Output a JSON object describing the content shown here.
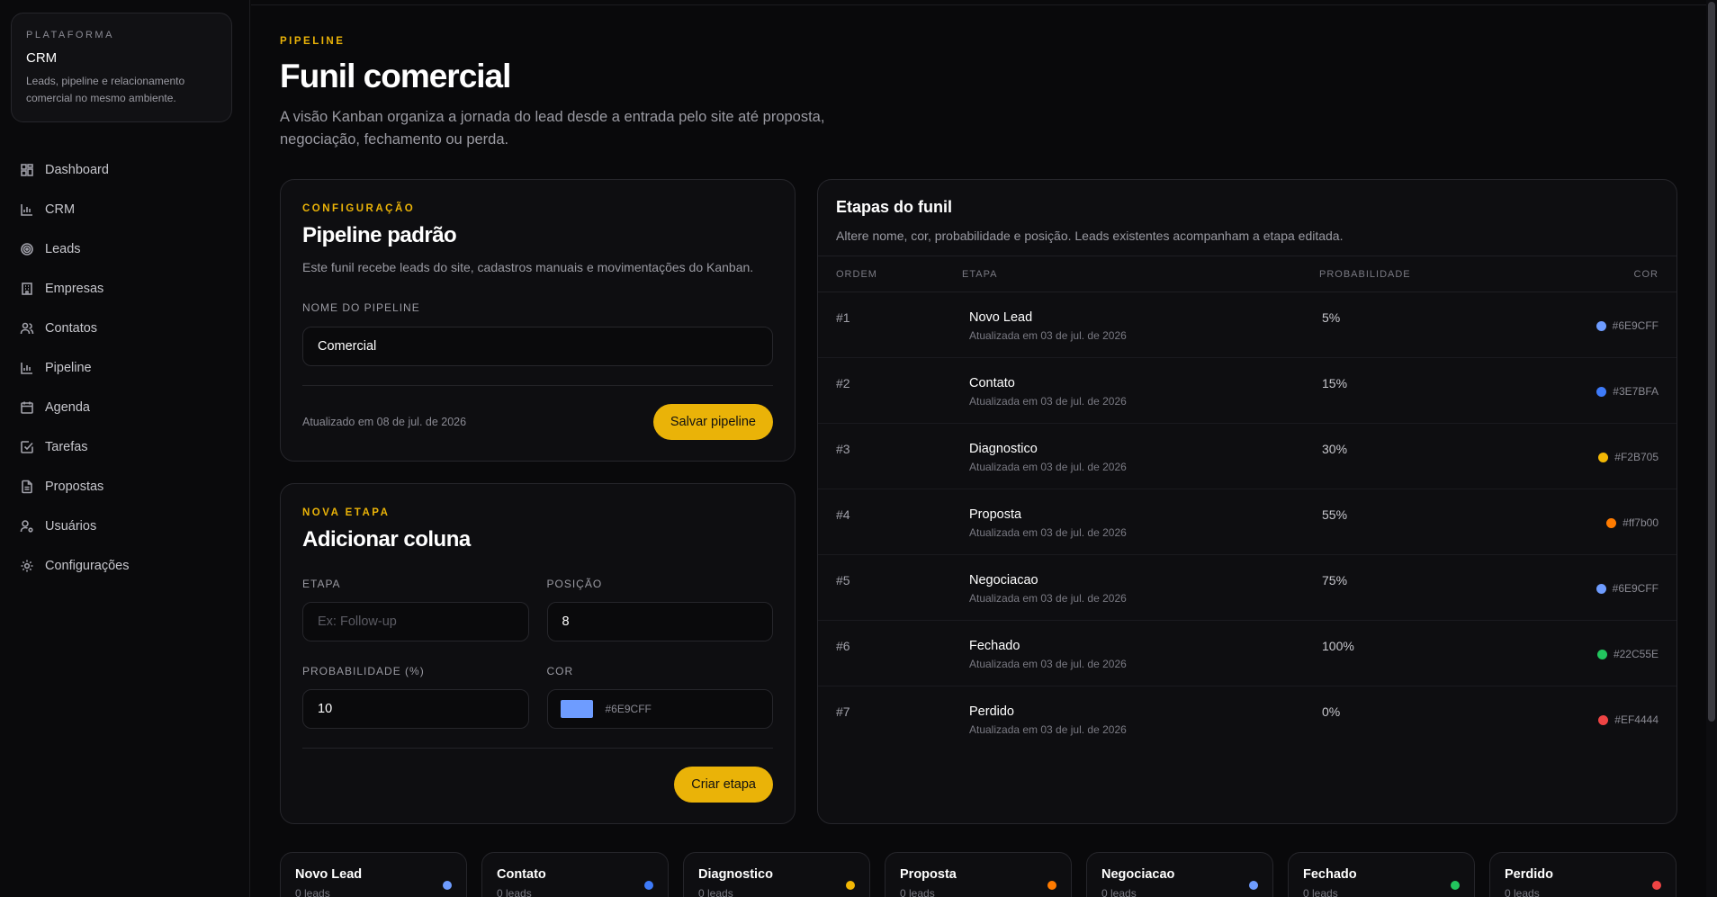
{
  "sidebar": {
    "eyebrow": "PLATAFORMA",
    "title": "CRM",
    "description": "Leads, pipeline e relacionamento comercial no mesmo ambiente.",
    "items": [
      {
        "label": "Dashboard",
        "icon": "grid-icon"
      },
      {
        "label": "CRM",
        "icon": "bar-chart-icon"
      },
      {
        "label": "Leads",
        "icon": "target-icon"
      },
      {
        "label": "Empresas",
        "icon": "building-icon"
      },
      {
        "label": "Contatos",
        "icon": "users-icon"
      },
      {
        "label": "Pipeline",
        "icon": "bar-chart-icon"
      },
      {
        "label": "Agenda",
        "icon": "calendar-icon"
      },
      {
        "label": "Tarefas",
        "icon": "check-square-icon"
      },
      {
        "label": "Propostas",
        "icon": "file-text-icon"
      },
      {
        "label": "Usuários",
        "icon": "user-cog-icon"
      },
      {
        "label": "Configurações",
        "icon": "gear-icon"
      }
    ]
  },
  "page": {
    "eyebrow": "PIPELINE",
    "title": "Funil comercial",
    "description": "A visão Kanban organiza a jornada do lead desde a entrada pelo site até proposta, negociação, fechamento ou perda."
  },
  "config": {
    "eyebrow": "CONFIGURAÇÃO",
    "title": "Pipeline padrão",
    "description": "Este funil recebe leads do site, cadastros manuais e movimentações do Kanban.",
    "name_label": "NOME DO PIPELINE",
    "name_value": "Comercial",
    "updated": "Atualizado em 08 de jul. de 2026",
    "save_label": "Salvar pipeline"
  },
  "new_stage": {
    "eyebrow": "NOVA ETAPA",
    "title": "Adicionar coluna",
    "stage_label": "ETAPA",
    "stage_placeholder": "Ex: Follow-up",
    "position_label": "POSIÇÃO",
    "position_value": "8",
    "prob_label": "PROBABILIDADE (%)",
    "prob_value": "10",
    "color_label": "COR",
    "color_value": "#6E9CFF",
    "create_label": "Criar etapa"
  },
  "stages": {
    "title": "Etapas do funil",
    "description": "Altere nome, cor, probabilidade e posição. Leads existentes acompanham a etapa editada.",
    "headers": {
      "order": "ORDEM",
      "stage": "ETAPA",
      "prob": "PROBABILIDADE",
      "color": "COR"
    },
    "rows": [
      {
        "order": "#1",
        "name": "Novo Lead",
        "updated": "Atualizada em 03 de jul. de 2026",
        "prob": "5%",
        "color": "#6E9CFF"
      },
      {
        "order": "#2",
        "name": "Contato",
        "updated": "Atualizada em 03 de jul. de 2026",
        "prob": "15%",
        "color": "#3E7BFA"
      },
      {
        "order": "#3",
        "name": "Diagnostico",
        "updated": "Atualizada em 03 de jul. de 2026",
        "prob": "30%",
        "color": "#F2B705"
      },
      {
        "order": "#4",
        "name": "Proposta",
        "updated": "Atualizada em 03 de jul. de 2026",
        "prob": "55%",
        "color": "#ff7b00"
      },
      {
        "order": "#5",
        "name": "Negociacao",
        "updated": "Atualizada em 03 de jul. de 2026",
        "prob": "75%",
        "color": "#6E9CFF"
      },
      {
        "order": "#6",
        "name": "Fechado",
        "updated": "Atualizada em 03 de jul. de 2026",
        "prob": "100%",
        "color": "#22C55E"
      },
      {
        "order": "#7",
        "name": "Perdido",
        "updated": "Atualizada em 03 de jul. de 2026",
        "prob": "0%",
        "color": "#EF4444"
      }
    ]
  },
  "kanban": [
    {
      "name": "Novo Lead",
      "count": "0 leads",
      "color": "#6E9CFF"
    },
    {
      "name": "Contato",
      "count": "0 leads",
      "color": "#3E7BFA"
    },
    {
      "name": "Diagnostico",
      "count": "0 leads",
      "color": "#F2B705"
    },
    {
      "name": "Proposta",
      "count": "0 leads",
      "color": "#ff7b00"
    },
    {
      "name": "Negociacao",
      "count": "0 leads",
      "color": "#6E9CFF"
    },
    {
      "name": "Fechado",
      "count": "0 leads",
      "color": "#22C55E"
    },
    {
      "name": "Perdido",
      "count": "0 leads",
      "color": "#EF4444"
    }
  ]
}
